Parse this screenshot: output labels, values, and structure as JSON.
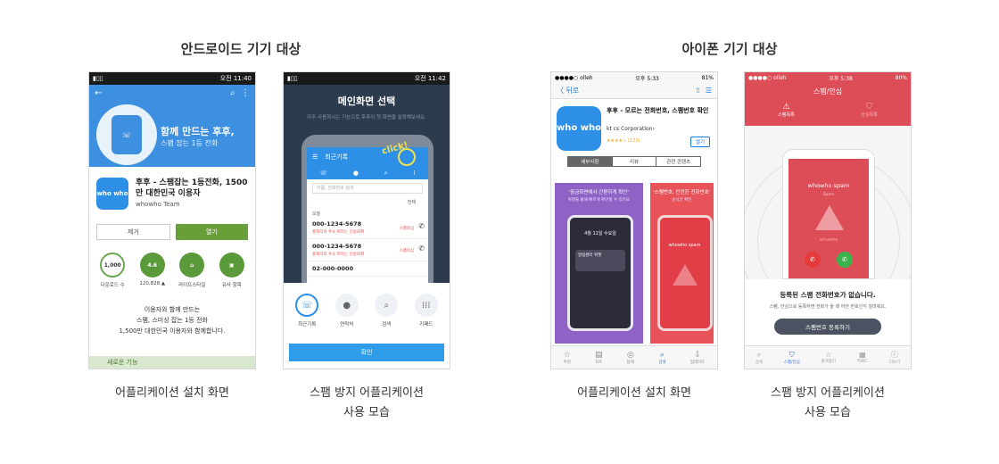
{
  "sections": {
    "android_title": "안드로이드 기기 대상",
    "iphone_title": "아이폰 기기 대상"
  },
  "captions": {
    "c1": "어플리케이션 설치 화면",
    "c2_line1": "스팸 방지 어플리케이션",
    "c2_line2": "사용 모습",
    "c3": "어플리케이션 설치 화면",
    "c4_line1": "스팸 방지 어플리케이션",
    "c4_line2": "사용 모습"
  },
  "phone1": {
    "status_time": "오전 11:40",
    "hero_title": "함께 만드는 후후,",
    "hero_sub": "스팸 잡는 1등 전화",
    "app_icon_text": "who who",
    "app_title": "후후 - 스팸잡는 1등전화, 1500만 대한민국 이용자",
    "developer": "whowho Team",
    "remove_label": "제거",
    "open_label": "열기",
    "stats": [
      {
        "value": "1,000",
        "label": "다운로드 수",
        "color": "#ffffff"
      },
      {
        "value": "4.6",
        "label": "120,828 ▲",
        "color": "#5b9a3a"
      },
      {
        "value": "⌂",
        "label": "라이프스타일",
        "color": "#5b9a3a"
      },
      {
        "value": "▣",
        "label": "유사 항목",
        "color": "#5b9a3a"
      }
    ],
    "desc_line1": "이용자와 함께 만드는",
    "desc_line2": "스팸, 스미싱 잡는 1등 전화",
    "desc_line3": "1,500만 대한민국 이용자와 함께합니다.",
    "new_features": "새로운 기능"
  },
  "phone2": {
    "status_time": "오전 11:42",
    "bg_title": "메인화면 선택",
    "bg_sub": "자주 사용하시는 기능으로 후후의 첫 화면을 설정해보세요.",
    "click_label": "click!",
    "header_title": "최근기록",
    "search_placeholder": "이름, 전화번호 검색",
    "filter_label": "전체",
    "day_label": "오늘",
    "calls": [
      {
        "number": "000-1234-5678",
        "meta": "홍해리의 주소 따라는 신용회제",
        "tag": "스팸의심"
      },
      {
        "number": "000-1234-5678",
        "meta": "홍해리의 주소 따라는 신용회제",
        "tag": "스팸의심"
      },
      {
        "number": "02-000-0000",
        "meta": "",
        "tag": ""
      }
    ],
    "menu": [
      {
        "icon": "☏",
        "label": "최근기록"
      },
      {
        "icon": "●",
        "label": "연락처"
      },
      {
        "icon": "⌕",
        "label": "검색"
      },
      {
        "icon": "⁞⁞⁞",
        "label": "키패드"
      }
    ],
    "confirm_label": "확인"
  },
  "phone3": {
    "status_carrier": "●●●●○ olleh",
    "status_time": "오후 5:33",
    "status_batt": "81%",
    "back_label": "〈 뒤로",
    "app_icon_text": "who who",
    "app_title": "후후 - 모르는 전화번호, 스팸번호 확인",
    "company": "kt cs Corporation›",
    "rating": "★★★★☆ (173)",
    "get_label": "열기",
    "segments": [
      "세부사항",
      "리뷰",
      "관련 콘텐츠"
    ],
    "shot1_title": "'잠금화면에서 간편하게 확인'",
    "shot1_sub": "위젯을 통해 빠르게 확인할 수 있어요",
    "shot1_date": "4월 11일 수요일",
    "shot1_notif": "알림센터 위젯",
    "shot2_title": "'스팸번호, 안전한 전화번호'",
    "shot2_sub": "순식간 확인",
    "shot2_spam": "whowho spam",
    "tabs": [
      {
        "icon": "☆",
        "label": "추천"
      },
      {
        "icon": "▤",
        "label": "차트"
      },
      {
        "icon": "◎",
        "label": "탐색"
      },
      {
        "icon": "⌕",
        "label": "검색"
      },
      {
        "icon": "⇩",
        "label": "업데이트"
      }
    ]
  },
  "phone4": {
    "status_carrier": "●●●●○ olleh",
    "status_time": "오후 5:38",
    "status_batt": "80%",
    "title": "스팸/안심",
    "tab_spam": "스팸목록",
    "tab_safe": "안심목록",
    "spam_name": "whowho spam",
    "spam_sub": "Spam",
    "watermark": "whowhe",
    "msg1": "등록된 스팸 전화번호가 없습니다.",
    "msg2": "스팸, 안심으로 등록하면 전화가 올 때 어떤 번호인지 알려줘요.",
    "register_label": "스팸번호 등록하기",
    "tabs": [
      {
        "icon": "⌕",
        "label": "검색"
      },
      {
        "icon": "⛉",
        "label": "스팸/안심",
        "on": true
      },
      {
        "icon": "☆",
        "label": "즐겨찾기"
      },
      {
        "icon": "▦",
        "label": "키패드"
      },
      {
        "icon": "ⓘ",
        "label": "더보기"
      }
    ]
  }
}
